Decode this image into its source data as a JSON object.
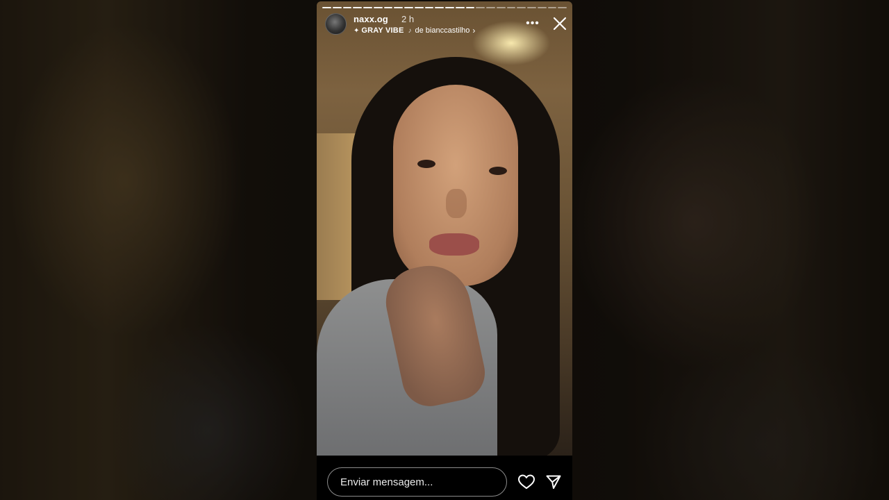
{
  "story": {
    "username": "naxx.og",
    "time_ago": "2 h",
    "music": {
      "sparkle_icon": "sparkle-icon",
      "song_title": "GRAY VIBE",
      "note_icon": "music-note-icon",
      "attribution": "de bianccastilho",
      "chevron": "›"
    },
    "progress_segments_total": 24,
    "progress_segments_done": 15,
    "more_icon": "more-icon",
    "close_icon": "close-icon"
  },
  "bottom_bar": {
    "message_placeholder": "Enviar mensagem...",
    "like_icon": "heart-icon",
    "share_icon": "send-icon"
  },
  "colors": {
    "overlay_text": "#ffffff",
    "bar_background": "#000000",
    "input_border": "#cccccc"
  }
}
